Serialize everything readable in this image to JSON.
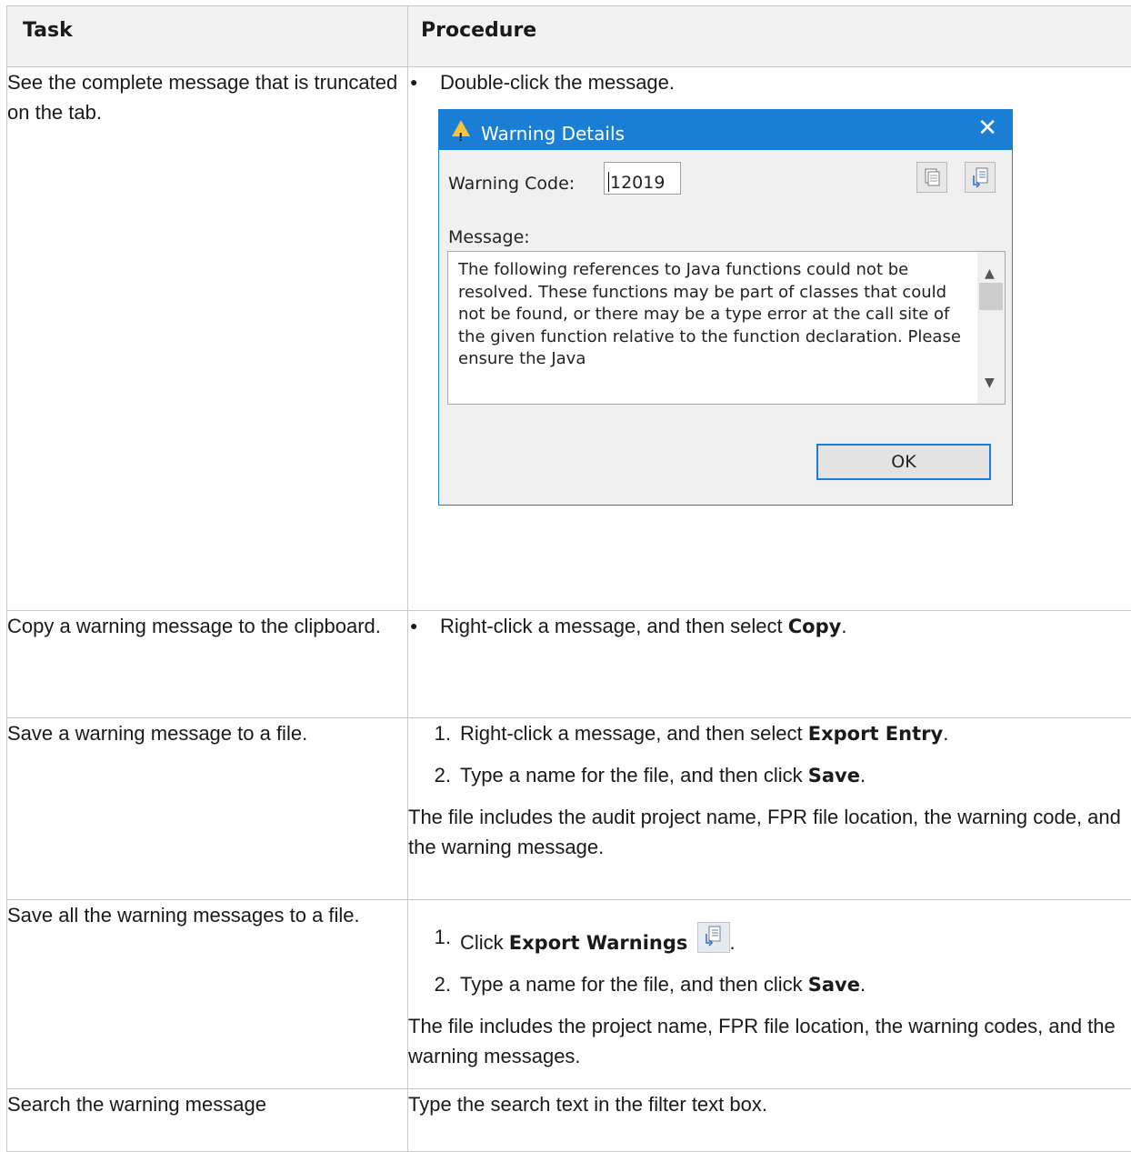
{
  "header": {
    "task": "Task",
    "procedure": "Procedure"
  },
  "rows": [
    {
      "task": "See the complete message that is truncated on the tab.",
      "bullet": "Double-click the message.",
      "dialog": {
        "title": "Warning Details",
        "close": "✕",
        "code_label": "Warning Code:",
        "code_value": "12019",
        "message_label": "Message:",
        "message_text": "The following references to Java functions could not be resolved. These functions may be part of classes that could not be found, or there may be a type error at the call site of the given function relative to the function declaration. Please ensure the Java",
        "ok": "OK",
        "accent": "#1a7fd4"
      }
    },
    {
      "task": "Copy a warning message to the clipboard.",
      "bullet_pre": "Right-click a message, and then select ",
      "bullet_bold": "Copy",
      "bullet_post": "."
    },
    {
      "task": "Save a warning message to a file.",
      "steps": [
        {
          "n": "1.",
          "pre": "Right-click a message, and then select ",
          "bold": "Export Entry",
          "post": "."
        },
        {
          "n": "2.",
          "pre": "Type a name for the file, and then click ",
          "bold": "Save",
          "post": "."
        }
      ],
      "note": "The file includes the audit project name, FPR file location, the warning code, and the warning message."
    },
    {
      "task": "Save all the warning messages to a file.",
      "steps": [
        {
          "n": "1.",
          "pre": "Click ",
          "bold": "Export Warnings",
          "post": "."
        },
        {
          "n": "2.",
          "pre": "Type a name for the file, and then click ",
          "bold": "Save",
          "post": "."
        }
      ],
      "note": "The file includes the project name, FPR file location, the warning codes, and the warning messages."
    },
    {
      "task": "Search the warning message",
      "text": "Type the search text in the filter text box."
    }
  ],
  "icons": {
    "warning": "warning-triangle-icon",
    "copy": "copy-icon",
    "export": "export-warnings-icon",
    "scroll_up": "▲",
    "scroll_down": "▼"
  }
}
